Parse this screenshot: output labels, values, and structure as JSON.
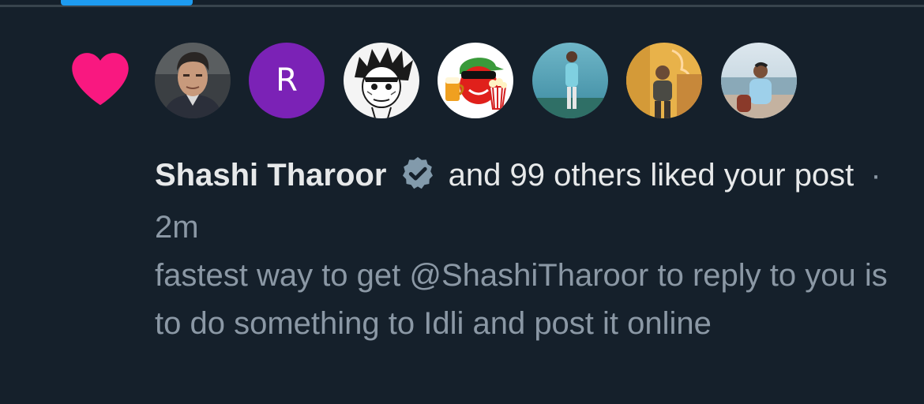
{
  "tab": {
    "active_indicator_color": "#1d9bf0"
  },
  "notification": {
    "type_icon": "heart-icon",
    "type_icon_color": "#f91880",
    "avatars": [
      {
        "icon": "profile-photo-man-suit"
      },
      {
        "letter": "R",
        "color": "#7b22b6"
      },
      {
        "icon": "profile-photo-anime-sketch"
      },
      {
        "icon": "profile-photo-cartoon-beer-popcorn"
      },
      {
        "icon": "profile-photo-man-outdoors"
      },
      {
        "icon": "profile-photo-man-neon-wall"
      },
      {
        "icon": "profile-photo-man-seaside"
      }
    ],
    "actor_name": "Shashi Tharoor",
    "verified_icon": "verified-badge-icon",
    "action_text": "and 99 others liked your post",
    "separator": "·",
    "time": "2m",
    "post_text": "fastest way to get @ShashiTharoor to reply to you is to do something to Idli and post it online"
  }
}
